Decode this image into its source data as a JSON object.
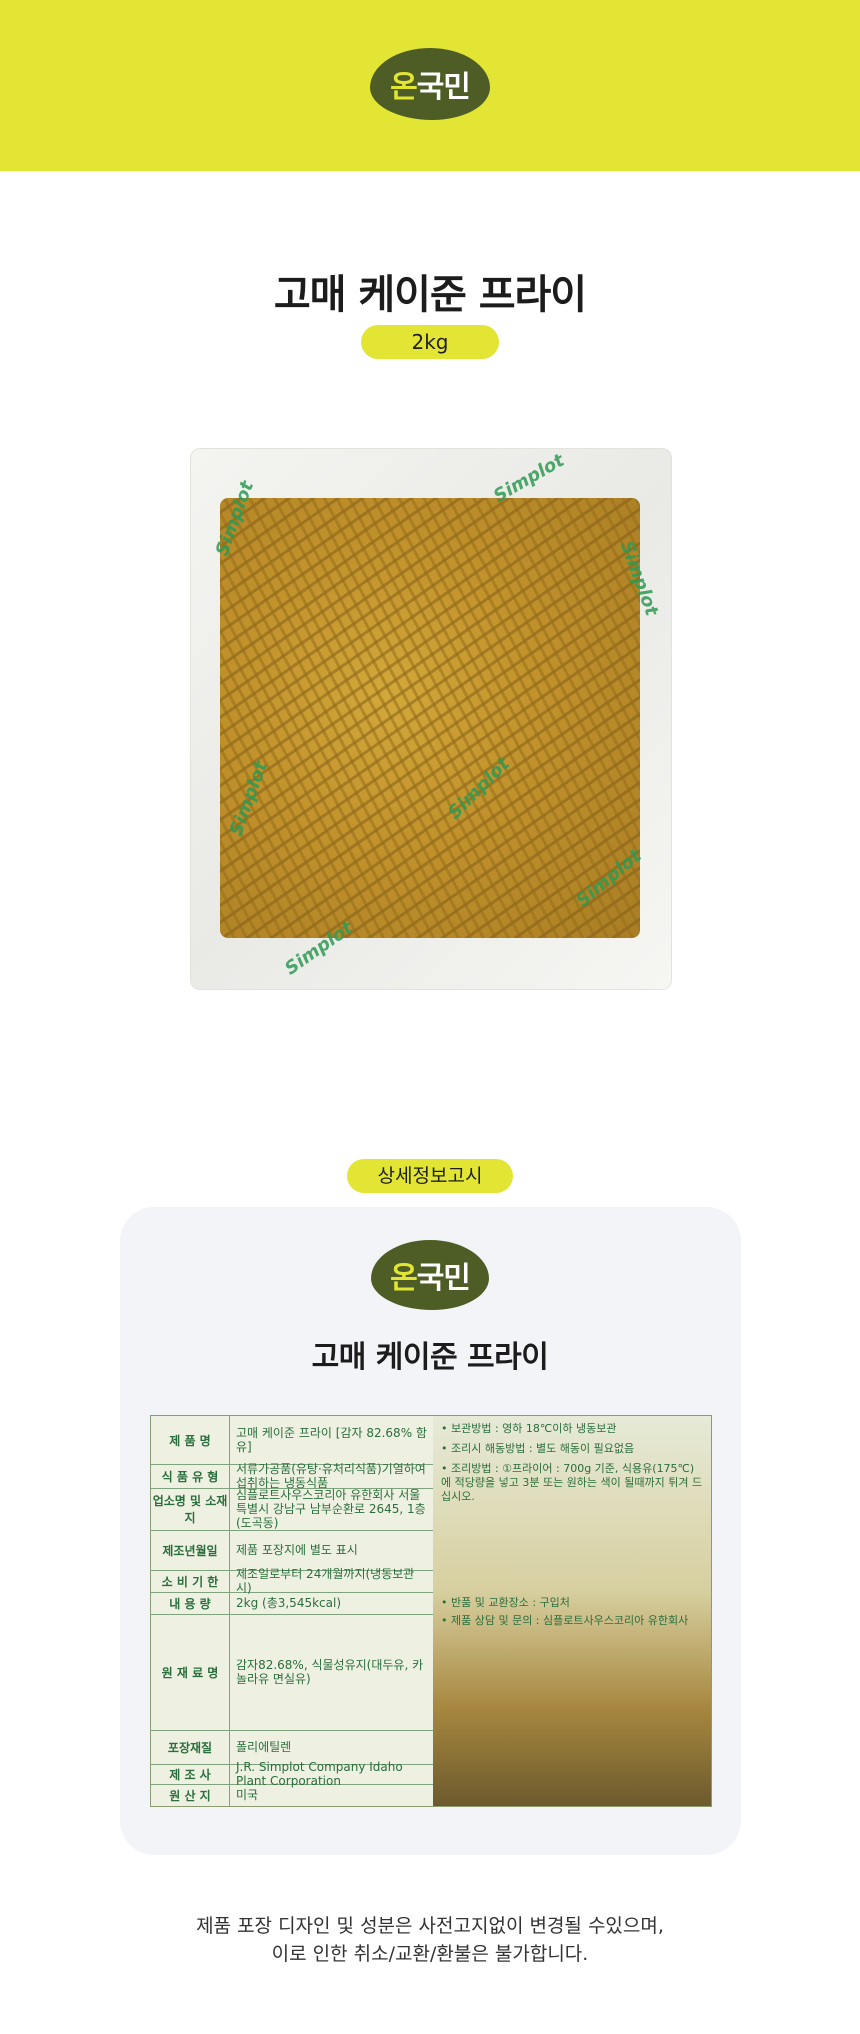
{
  "header": {
    "logo_text_a": "온",
    "logo_text_b": "국민"
  },
  "product": {
    "name": "고매  케이준 프라이",
    "weight": "2kg"
  },
  "bag": {
    "brand": "Simplot"
  },
  "notice": {
    "label": "상세정보고시",
    "card_title": "고매 케이준 프라이"
  },
  "label_table": {
    "rows": [
      {
        "key": "제 품 명",
        "value": "고매 케이준 프라이 [감자 82.68% 함유]"
      },
      {
        "key": "식 품 유 형",
        "value": "서류가공품(유탕·유처리식품)기열하여 섭취하는 냉동식품"
      },
      {
        "key": "업소명 및 소재지",
        "value": "심플로트사우스코리아 유한회사 서울특별시 강남구 남부순환로 2645, 1층(도곡동)"
      },
      {
        "key": "제조년월일",
        "value": "제품 포장지에 별도 표시"
      },
      {
        "key": "소 비 기 한",
        "value": "제조일로부터 24개월까지(냉동보관시)"
      },
      {
        "key": "내 용 량",
        "value": "2kg (총3,545kcal)"
      },
      {
        "key": "원 재 료 명",
        "value": "감자82.68%, 식물성유지(대두유, 카놀라유 면실유)"
      },
      {
        "key": "포장재질",
        "value": "폴리에틸렌"
      },
      {
        "key": "제 조 사",
        "value": "J.R. Simplot Company Idaho Plant Corporation"
      },
      {
        "key": "원 산 지",
        "value": "미국"
      }
    ],
    "notes": [
      "• 보관방법 : 영하 18℃이하 냉동보관",
      "• 조리시 해동방법 : 별도 해동이 필요없음",
      "• 조리방법 : ①프라이어 : 700g 기준, 식용유(175℃)에 적당량을 넣고 3분 또는 원하는 색이 될때까지 튀겨 드십시오.",
      "• 반품 및 교환장소 : 구입처",
      "• 제품 상담 및 문의 : 심플로트사우스코리아 유한회사"
    ]
  },
  "footer": {
    "line1": "제품 포장 디자인 및 성분은 사전고지없이 변경될 수있으며,",
    "line2": "이로 인한 취소/교환/환불은 불가합니다."
  }
}
